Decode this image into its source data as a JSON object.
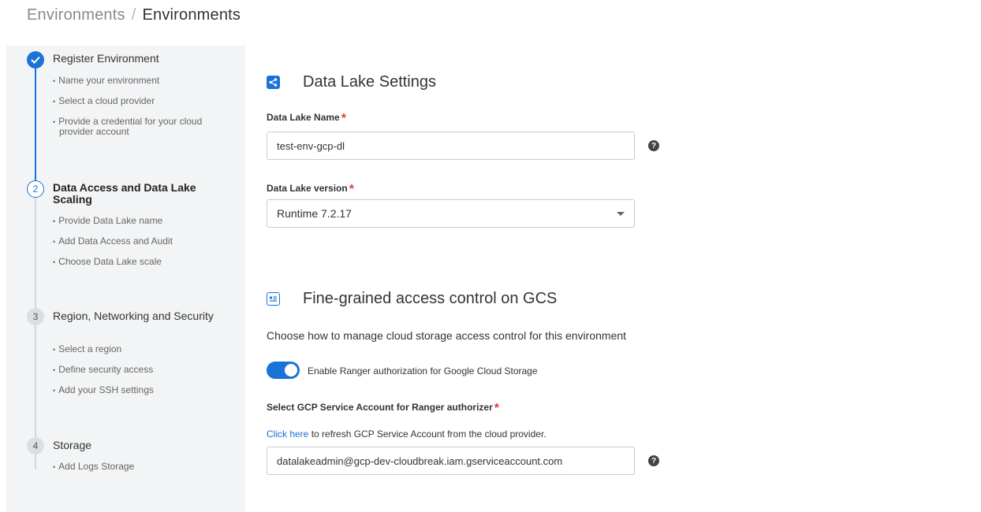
{
  "breadcrumb": {
    "parent": "Environments",
    "separator": "/",
    "current": "Environments"
  },
  "steps": [
    {
      "number": "1",
      "status": "completed",
      "title": "Register Environment",
      "items": [
        "Name your environment",
        "Select a cloud provider",
        "Provide a credential for your cloud provider account"
      ]
    },
    {
      "number": "2",
      "status": "active",
      "title": "Data Access and Data Lake Scaling",
      "items": [
        "Provide Data Lake name",
        "Add Data Access and Audit",
        "Choose Data Lake scale"
      ]
    },
    {
      "number": "3",
      "status": "pending",
      "title": "Region, Networking and Security",
      "items": [
        "Select a region",
        "Define security access",
        "Add your SSH settings"
      ]
    },
    {
      "number": "4",
      "status": "pending",
      "title": "Storage",
      "items": [
        "Add Logs Storage"
      ]
    }
  ],
  "data_lake_settings": {
    "title": "Data Lake Settings",
    "icon": "share-icon",
    "name_label": "Data Lake Name",
    "name_value": "test-env-gcp-dl",
    "version_label": "Data Lake version",
    "version_value": "Runtime 7.2.17",
    "required_marker": "*"
  },
  "fine_grained": {
    "title": "Fine-grained access control on GCS",
    "icon": "id-card-icon",
    "description": "Choose how to manage cloud storage access control for this environment",
    "toggle_label": "Enable Ranger authorization for Google Cloud Storage",
    "toggle_on": true,
    "service_account_label": "Select GCP Service Account for Ranger authorizer",
    "refresh_link": "Click here",
    "refresh_text": " to refresh GCP Service Account from the cloud provider.",
    "service_account_value": "datalakeadmin@gcp-dev-cloudbreak.iam.gserviceaccount.com"
  },
  "help_icon_glyph": "?",
  "colors": {
    "accent": "#1a73d6",
    "required": "#e0403b",
    "sidebar_bg": "#f3f4f5"
  }
}
